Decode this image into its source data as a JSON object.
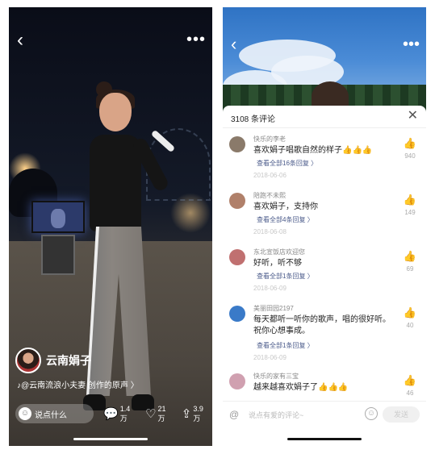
{
  "left": {
    "back_icon": "chevron-left-icon",
    "more_icon": "ellipsis-icon",
    "author_name": "云南娟子",
    "music": "♪@云南流浪小夫妻 创作的原声 〉",
    "say_placeholder": "说点什么",
    "comments_count": "1.4万",
    "likes_count": "21万",
    "shares_count": "3.9万"
  },
  "right": {
    "comment_count_title": "3108 条评论",
    "close_icon": "close-icon",
    "comments": [
      {
        "user": "快乐的李老",
        "text": "喜欢娟子唱歌自然的样子👍👍👍",
        "replies": "查看全部16条回复 〉",
        "date": "2018-06-06",
        "likes": "940",
        "avatar_color": "#8a7a6a"
      },
      {
        "user": "陪跑不未熙",
        "text": "喜欢娟子，支持你",
        "replies": "查看全部4条回复 〉",
        "date": "2018-06-08",
        "likes": "149",
        "avatar_color": "#b0806a"
      },
      {
        "user": "东北宣饭店欢迎您",
        "text": "好听，听不够",
        "replies": "查看全部1条回复 〉",
        "date": "2018-06-09",
        "likes": "69",
        "avatar_color": "#c07070"
      },
      {
        "user": "美丽田园2197",
        "text": "每天都听一听你的歌声，唱的很好听。祝你心想事成。",
        "replies": "查看全部1条回复 〉",
        "date": "2018-06-09",
        "likes": "40",
        "avatar_color": "#3a7ac8"
      },
      {
        "user": "快乐的家有三宝",
        "text": "越来越喜欢娟子了👍👍👍",
        "replies": "",
        "date": "",
        "likes": "46",
        "avatar_color": "#d0a0b0"
      }
    ],
    "input_placeholder": "说点有爱的评论~",
    "send_label": "发送"
  }
}
